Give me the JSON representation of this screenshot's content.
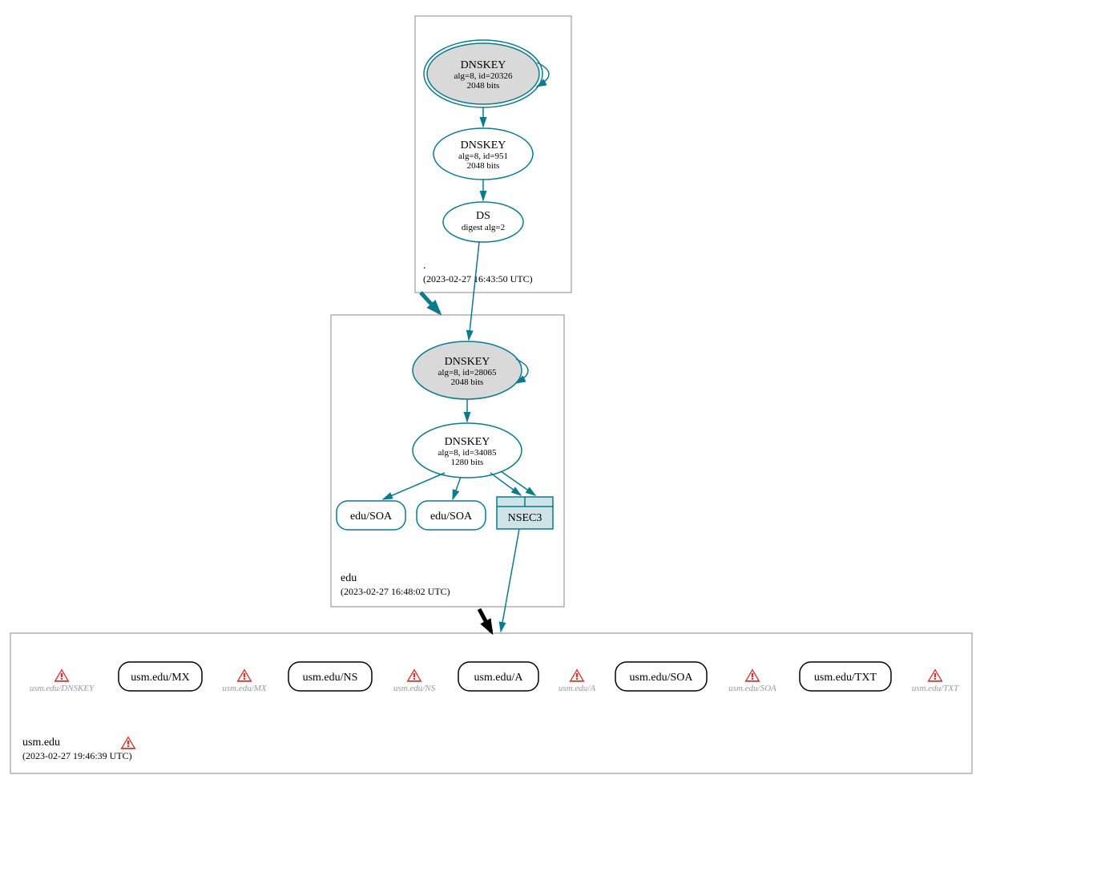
{
  "zones": {
    "root": {
      "label": ".",
      "timestamp": "(2023-02-27 16:43:50 UTC)",
      "dnskey1": {
        "title": "DNSKEY",
        "line2": "alg=8, id=20326",
        "line3": "2048 bits"
      },
      "dnskey2": {
        "title": "DNSKEY",
        "line2": "alg=8, id=951",
        "line3": "2048 bits"
      },
      "ds": {
        "title": "DS",
        "line2": "digest alg=2"
      }
    },
    "edu": {
      "label": "edu",
      "timestamp": "(2023-02-27 16:48:02 UTC)",
      "dnskey1": {
        "title": "DNSKEY",
        "line2": "alg=8, id=28065",
        "line3": "2048 bits"
      },
      "dnskey2": {
        "title": "DNSKEY",
        "line2": "alg=8, id=34085",
        "line3": "1280 bits"
      },
      "soa1": "edu/SOA",
      "soa2": "edu/SOA",
      "nsec3": "NSEC3"
    },
    "usm": {
      "label": "usm.edu",
      "timestamp": "(2023-02-27 19:46:39 UTC)",
      "items": [
        {
          "gray": "usm.edu/DNSKEY"
        },
        {
          "box": "usm.edu/MX"
        },
        {
          "gray": "usm.edu/MX"
        },
        {
          "box": "usm.edu/NS"
        },
        {
          "gray": "usm.edu/NS"
        },
        {
          "box": "usm.edu/A"
        },
        {
          "gray": "usm.edu/A"
        },
        {
          "box": "usm.edu/SOA"
        },
        {
          "gray": "usm.edu/SOA"
        },
        {
          "box": "usm.edu/TXT"
        },
        {
          "gray": "usm.edu/TXT"
        }
      ]
    }
  }
}
